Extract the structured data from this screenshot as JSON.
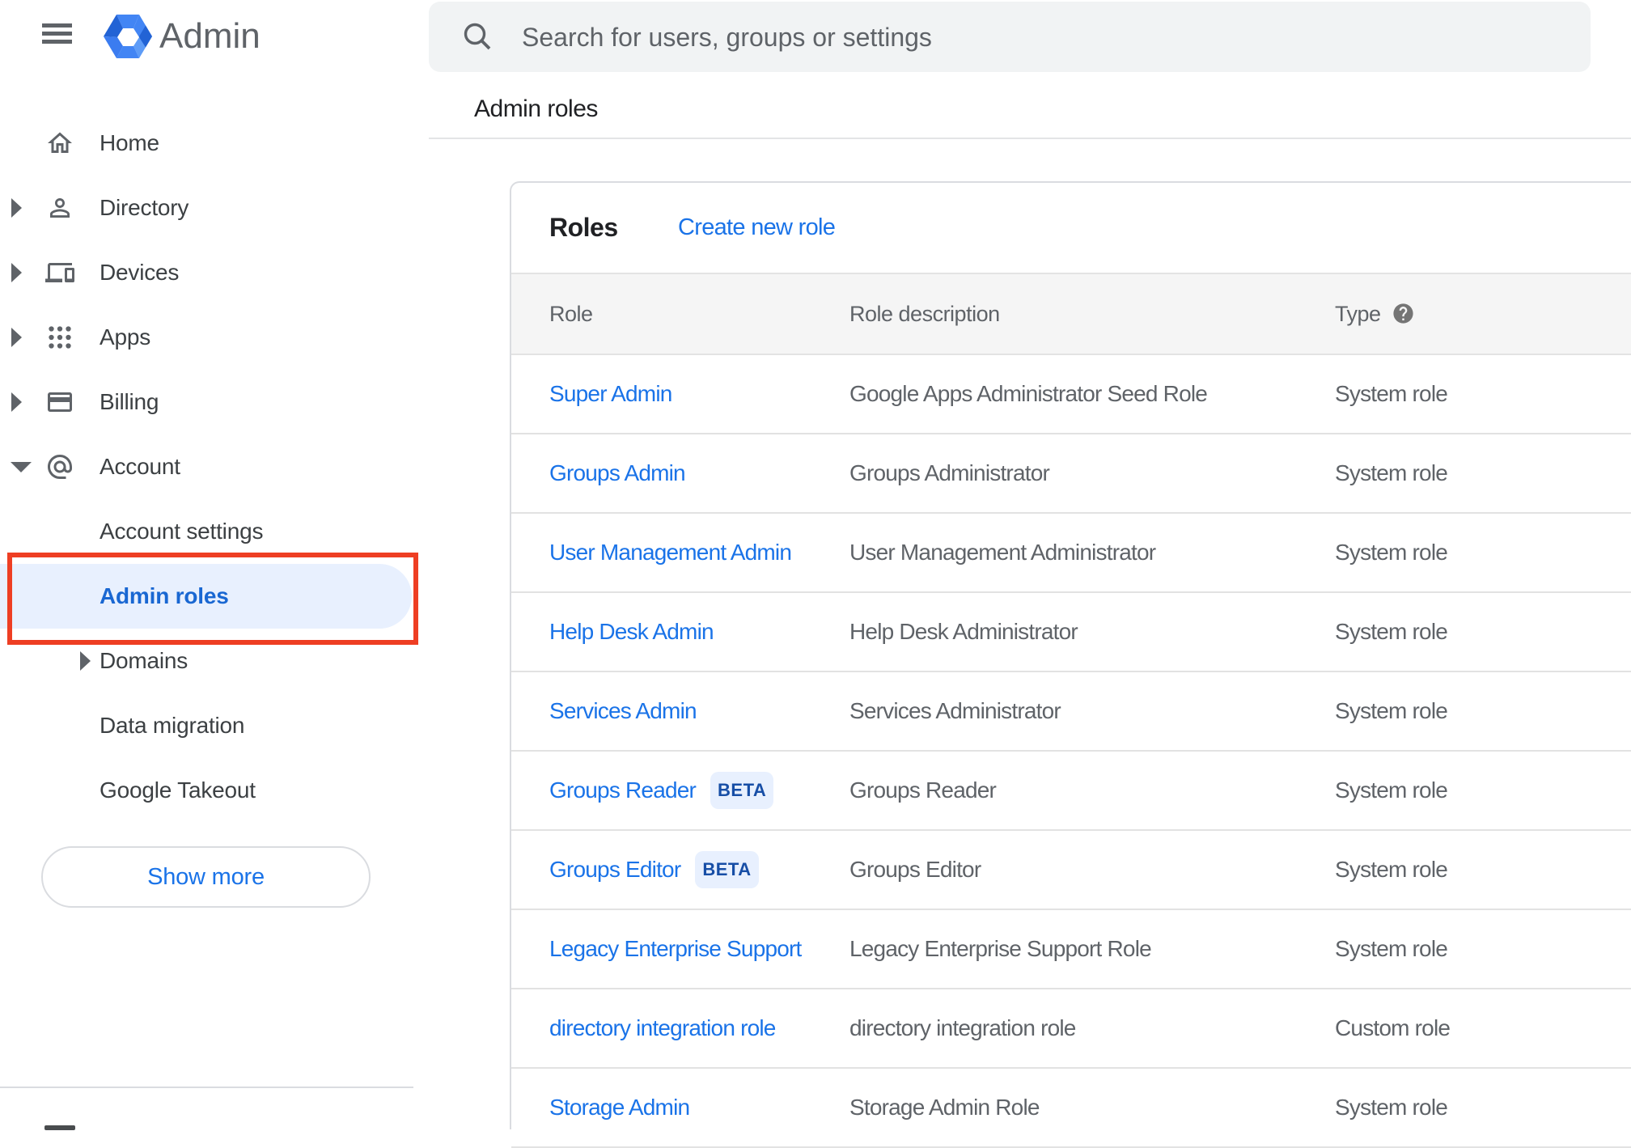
{
  "brand": {
    "product_name": "Admin"
  },
  "search": {
    "placeholder": "Search for users, groups or settings"
  },
  "page": {
    "title": "Admin roles"
  },
  "sidebar": {
    "items": [
      {
        "label": "Home"
      },
      {
        "label": "Directory"
      },
      {
        "label": "Devices"
      },
      {
        "label": "Apps"
      },
      {
        "label": "Billing"
      },
      {
        "label": "Account"
      },
      {
        "label": "Account settings"
      },
      {
        "label": "Admin roles",
        "selected": true
      },
      {
        "label": "Domains"
      },
      {
        "label": "Data migration"
      },
      {
        "label": "Google Takeout"
      }
    ],
    "show_more_label": "Show more"
  },
  "roles_card": {
    "title": "Roles",
    "create_link_label": "Create new role",
    "columns": {
      "role": "Role",
      "description": "Role description",
      "type": "Type"
    },
    "rows": [
      {
        "role": "Super Admin",
        "description": "Google Apps Administrator Seed Role",
        "type": "System role"
      },
      {
        "role": "Groups Admin",
        "description": "Groups Administrator",
        "type": "System role"
      },
      {
        "role": "User Management Admin",
        "description": "User Management Administrator",
        "type": "System role"
      },
      {
        "role": "Help Desk Admin",
        "description": "Help Desk Administrator",
        "type": "System role"
      },
      {
        "role": "Services Admin",
        "description": "Services Administrator",
        "type": "System role"
      },
      {
        "role": "Groups Reader",
        "badge": "BETA",
        "description": "Groups Reader",
        "type": "System role"
      },
      {
        "role": "Groups Editor",
        "badge": "BETA",
        "description": "Groups Editor",
        "type": "System role"
      },
      {
        "role": "Legacy Enterprise Support",
        "description": "Legacy Enterprise Support Role",
        "type": "System role"
      },
      {
        "role": "directory integration role",
        "description": "directory integration role",
        "type": "Custom role"
      },
      {
        "role": "Storage Admin",
        "description": "Storage Admin Role",
        "type": "System role"
      }
    ]
  },
  "annotation": {
    "color": "#e8432b",
    "target": "Admin roles sidebar item"
  },
  "colors": {
    "link_blue": "#1a73e8",
    "selected_blue": "#1967d2",
    "pill_blue": "#e8f0fe",
    "icon_gray": "#5f6368",
    "text_dark": "#202124",
    "search_bg": "#f1f3f4"
  }
}
